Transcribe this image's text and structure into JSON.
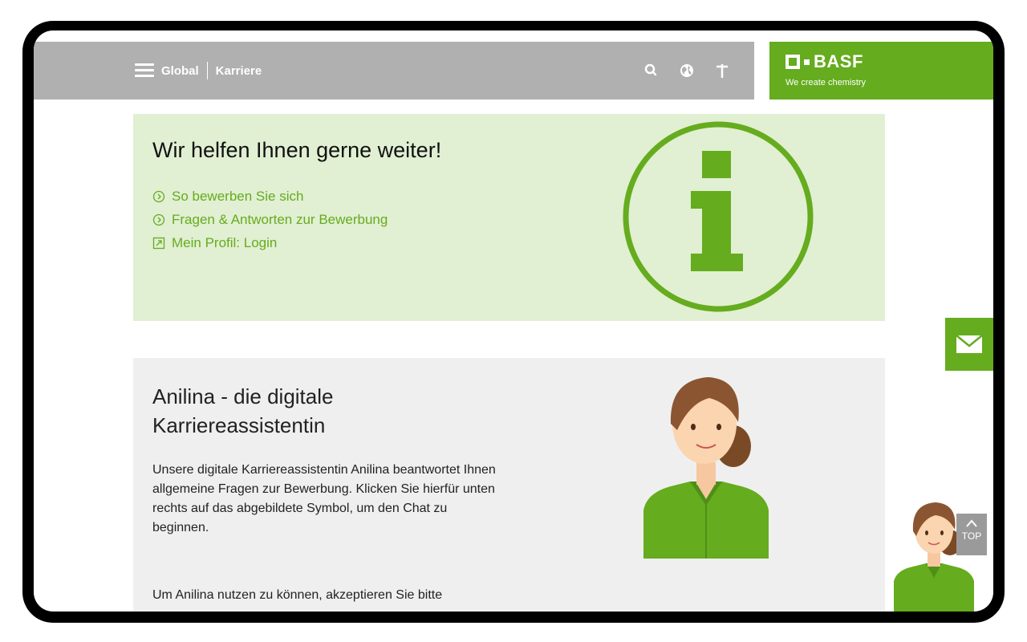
{
  "header": {
    "nav_global": "Global",
    "nav_karriere": "Karriere",
    "icons": [
      "menu-icon",
      "search-icon",
      "globe-icon",
      "accessibility-icon"
    ],
    "bar_color": "#b0b0b0"
  },
  "logo": {
    "name": "BASF",
    "tagline": "We create chemistry",
    "color": "#65ac1e"
  },
  "info_panel": {
    "title": "Wir helfen Ihnen gerne weiter!",
    "links": [
      {
        "label": "So bewerben Sie sich",
        "icon": "circle-chevron-icon"
      },
      {
        "label": "Fragen & Antworten zur Bewerbung",
        "icon": "circle-chevron-icon"
      },
      {
        "label": "Mein Profil: Login",
        "icon": "external-link-icon"
      }
    ],
    "graphic": "info-icon",
    "bg_color": "#e1efd2"
  },
  "anilina_panel": {
    "title": "Anilina - die digitale Karriereassistentin",
    "body": "Unsere digitale Karriereassistentin Anilina beantwortet Ihnen allgemeine Fragen zur Bewerbung. Klicken Sie hierfür unten rechts auf das abgebildete Symbol, um den Chat zu beginnen.",
    "body2": "Um Anilina nutzen zu können, akzeptieren Sie bitte"
  },
  "floating": {
    "mail_icon": "mail-icon",
    "top_label": "TOP"
  }
}
